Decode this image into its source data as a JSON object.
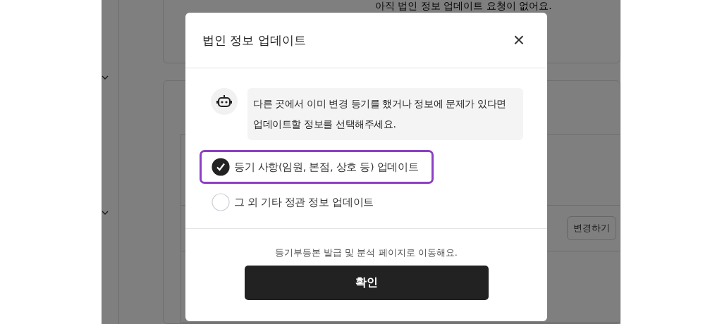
{
  "background": {
    "notice": "아직 법인 정보 업데이트 요청이 없어요.",
    "change_button": "변경하기"
  },
  "modal": {
    "title": "법인 정보 업데이트",
    "close": "×",
    "message": "다른 곳에서 이미 변경 등기를 했거나 정보에 문제가 있다면 업데이트할 정보를 선택해주세요.",
    "options": [
      {
        "label": "등기 사항(임원, 본점, 상호 등) 업데이트",
        "selected": true
      },
      {
        "label": "그 외 기타 정관 정보 업데이트",
        "selected": false
      }
    ],
    "footer_note": "등기부등본 발급 및 분석 페이지로 이동해요.",
    "confirm_button": "확인"
  }
}
